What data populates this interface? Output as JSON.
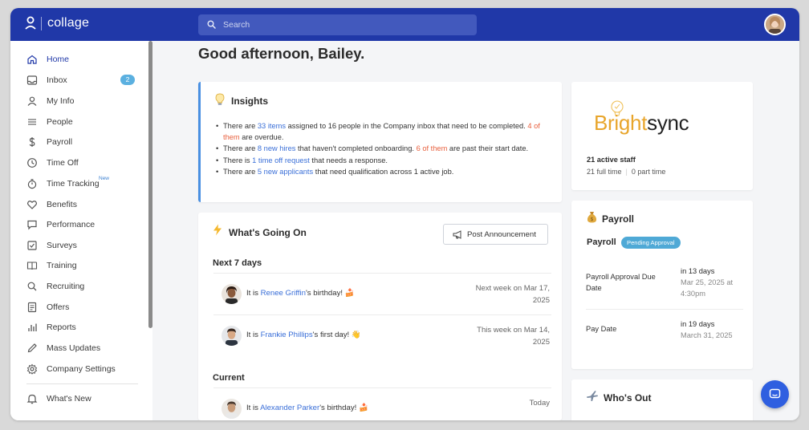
{
  "app": {
    "name": "collage"
  },
  "search": {
    "placeholder": "Search"
  },
  "sidebar": {
    "items": [
      {
        "label": "Home",
        "icon": "home-icon",
        "active": true
      },
      {
        "label": "Inbox",
        "icon": "inbox-icon",
        "badge": "2"
      },
      {
        "label": "My Info",
        "icon": "user-icon"
      },
      {
        "label": "People",
        "icon": "list-icon"
      },
      {
        "label": "Payroll",
        "icon": "dollar-icon"
      },
      {
        "label": "Time Off",
        "icon": "clock-icon"
      },
      {
        "label": "Time Tracking",
        "icon": "stopwatch-icon",
        "tag": "New"
      },
      {
        "label": "Benefits",
        "icon": "heart-icon"
      },
      {
        "label": "Performance",
        "icon": "chat-bubble-icon"
      },
      {
        "label": "Surveys",
        "icon": "checkbox-icon"
      },
      {
        "label": "Training",
        "icon": "book-icon"
      },
      {
        "label": "Recruiting",
        "icon": "magnifier-icon"
      },
      {
        "label": "Offers",
        "icon": "document-icon"
      },
      {
        "label": "Reports",
        "icon": "bar-chart-icon"
      },
      {
        "label": "Mass Updates",
        "icon": "pencil-icon"
      },
      {
        "label": "Company Settings",
        "icon": "gear-icon"
      },
      {
        "label": "What's New",
        "icon": "bell-icon"
      }
    ]
  },
  "main": {
    "greeting": "Good afternoon, Bailey.",
    "insights": {
      "title": "Insights",
      "b1": {
        "t1": "There are ",
        "link": "33 items",
        "t2": " assigned to 16 people in the Company inbox that need to be completed. ",
        "alert": "4 of them",
        "t3": " are overdue."
      },
      "b2": {
        "t1": "There are ",
        "link": "8 new hires",
        "t2": " that haven't completed onboarding. ",
        "alert": "6 of them",
        "t3": " are past their start date."
      },
      "b3": {
        "t1": "There is ",
        "link": "1 time off request",
        "t2": " that needs a response."
      },
      "b4": {
        "t1": "There are ",
        "link": "5 new applicants",
        "t2": " that need qualification across 1 active job."
      }
    },
    "going_on": {
      "title": "What's Going On",
      "post_button": "Post Announcement",
      "next_label": "Next 7 days",
      "current_label": "Current",
      "events": [
        {
          "prefix": "It is ",
          "name": "Renee Griffin",
          "suffix": "'s birthday!",
          "emoji": "🍰",
          "when1": "Next week on Mar 17,",
          "when2": "2025"
        },
        {
          "prefix": "It is ",
          "name": "Frankie Phillips",
          "suffix": "'s first day!",
          "emoji": "👋",
          "when1": "This week on Mar 14,",
          "when2": "2025"
        },
        {
          "prefix": "It is ",
          "name": "Alexander Parker",
          "suffix": "'s birthday!",
          "emoji": "🍰",
          "when1": "Today",
          "when2": ""
        }
      ]
    }
  },
  "company": {
    "logo_bright": "Bright",
    "logo_sync": "sync",
    "staff": "21 active staff",
    "full_time": "21 full time",
    "part_time": "0 part time"
  },
  "payroll": {
    "title": "Payroll",
    "subtitle": "Payroll",
    "status": "Pending Approval",
    "rows": [
      {
        "label": "Payroll Approval Due Date",
        "main": "in 13 days",
        "dim": "Mar 25, 2025 at 4:30pm"
      },
      {
        "label": "Pay Date",
        "main": "in 19 days",
        "dim": "March 31, 2025"
      }
    ]
  },
  "whos_out": {
    "title": "Who's Out"
  },
  "colors": {
    "brand": "#2038a8",
    "accent": "#3a6fd8",
    "alert": "#e8613f",
    "status_pill": "#4fa9d6"
  }
}
